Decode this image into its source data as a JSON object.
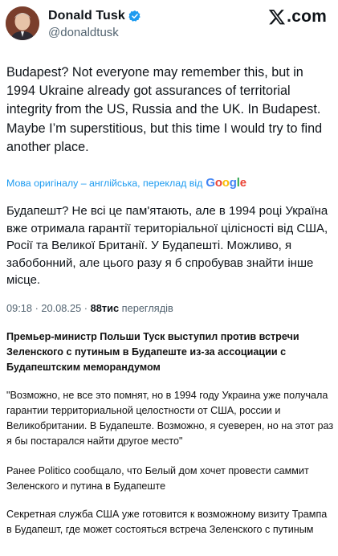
{
  "profile": {
    "name": "Donald Tusk",
    "handle": "@donaldtusk",
    "verified_icon": "verified-badge-icon"
  },
  "brand": {
    "logo_text": ".com"
  },
  "tweet": {
    "text_en": "Budapest? Not everyone may remember this, but in 1994 Ukraine already got assurances of territorial integrity from the US, Russia and the UK. In Budapest. Maybe I’m superstitious, but this time I would try to find another place.",
    "translation_note": "Мова оригіналу – англійська, переклад від",
    "translation_provider": "Google",
    "text_ua": "Будапешт? Не всі це пам'ятають, але в 1994 році Україна вже отримала гарантії територіальної цілісності від США, Росії та Великої Британії. У Будапешті. Можливо, я забобонний, але цього разу я б спробував знайти інше місце.",
    "time": "09:18 · 20.08.25 · ",
    "views_count": "88тис",
    "views_label": " переглядів"
  },
  "article": {
    "headline": "Премьер-министр Польши Туск выступил против встречи Зеленского с путиным в Будапеште из-за ассоциации с Будапештским меморандумом",
    "quote": "\"Возможно, не все это помнят, но в 1994 году Украина уже получала гарантии территориальной целостности от США, россии и Великобритании. В Будапеште. Возможно, я суеверен, но на этот раз я бы постарался найти другое место\"",
    "para1": "Ранее Politico сообщало, что Белый дом хочет провести саммит Зеленского и путина в Будапеште",
    "para2": "Секретная служба США уже готовится к возможному визиту Трампа в Будапешт, где может состояться встреча Зеленского с путиным"
  },
  "colors": {
    "link": "#1d9bf0",
    "muted": "#536471",
    "text": "#0f1419",
    "verified": "#1d9bf0"
  }
}
